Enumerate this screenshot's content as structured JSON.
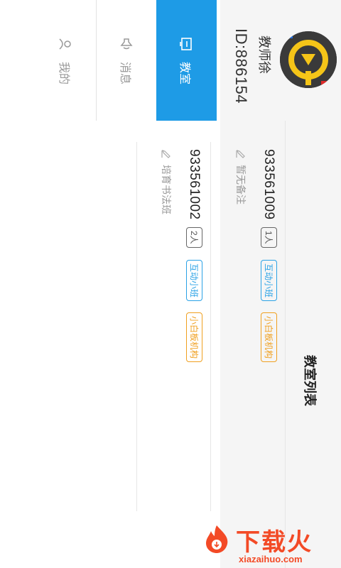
{
  "profile": {
    "name": "教师徐",
    "id_text": "ID:886154"
  },
  "tabs": [
    {
      "label": "教室",
      "icon": "classroom-icon",
      "active": true
    },
    {
      "label": "消息",
      "icon": "speaker-icon",
      "active": false
    },
    {
      "label": "我的",
      "icon": "user-icon",
      "active": false
    }
  ],
  "section": {
    "title": "教室列表"
  },
  "classrooms": [
    {
      "id": "933561009",
      "count": "1人",
      "tag_type": "互动小班",
      "tag_org": "小白板机构",
      "note": "暂无备注"
    },
    {
      "id": "933561002",
      "count": "2人",
      "tag_type": "互动小班",
      "tag_org": "小白板机构",
      "note": "培育书法班"
    }
  ],
  "watermark": {
    "brand": "下载火",
    "domain": "xiazaihuo.com"
  },
  "colors": {
    "accent": "#1e9be6",
    "tag_blue": "#2aa2e6",
    "tag_orange": "#f0a020",
    "watermark": "#f34a26"
  }
}
